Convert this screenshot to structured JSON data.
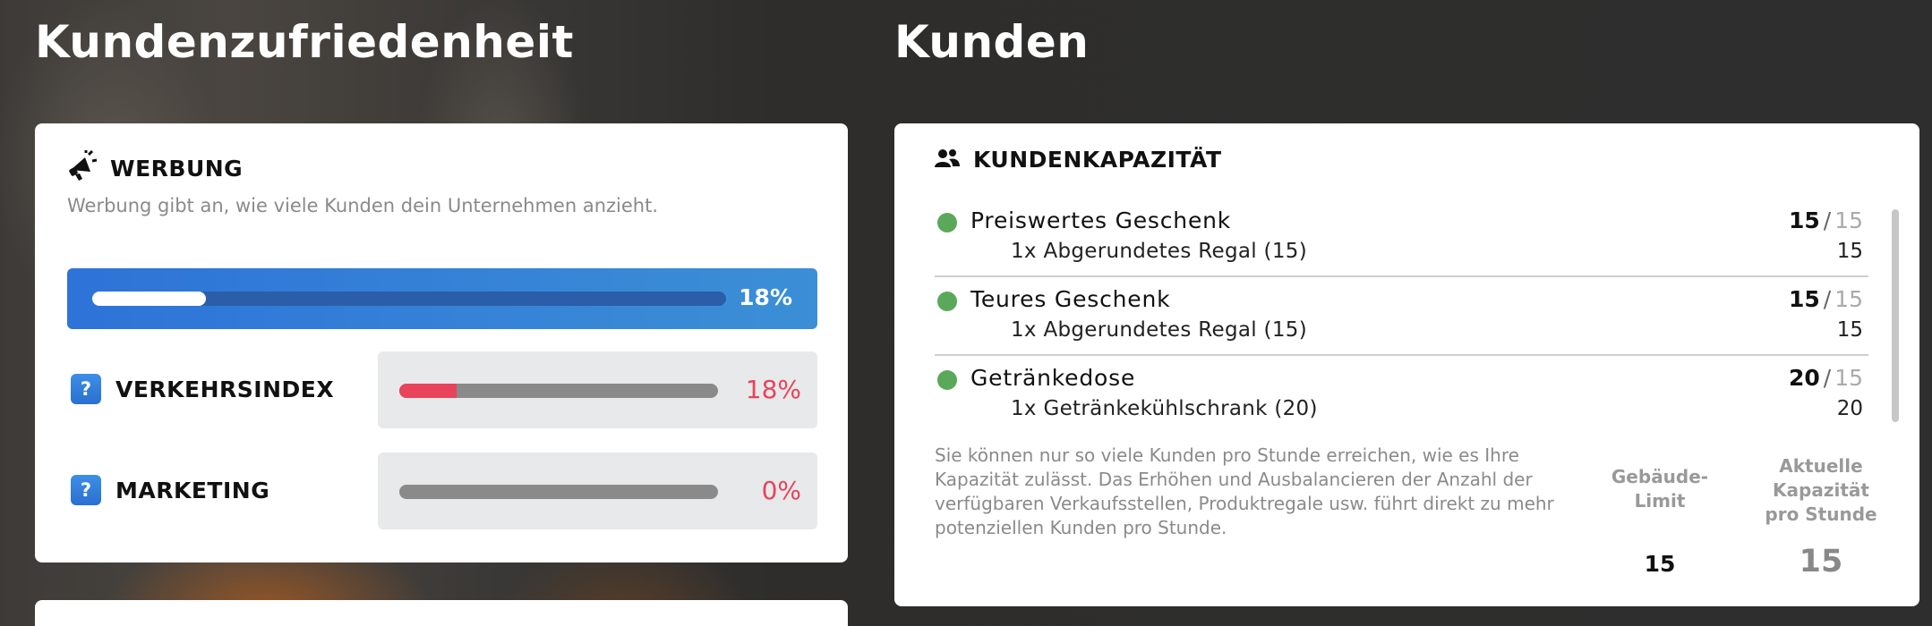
{
  "left_section": {
    "title": "Kundenzufriedenheit",
    "card": {
      "header_label": "WERBUNG",
      "description": "Werbung gibt an, wie viele Kunden dein Unternehmen anzieht.",
      "main_progress": {
        "value": 0.18,
        "label": "18%"
      },
      "metrics": [
        {
          "label": "VERKEHRSINDEX",
          "value": 0.18,
          "pct_label": "18%",
          "help_icon": "question-icon"
        },
        {
          "label": "MARKETING",
          "value": 0.0,
          "pct_label": "0%",
          "help_icon": "question-icon"
        }
      ],
      "icon": "megaphone-icon"
    }
  },
  "right_section": {
    "title": "Kunden",
    "card": {
      "header_label": "KUNDENKAPAZITÄT",
      "icon": "users-icon",
      "rows": [
        {
          "name": "Preiswertes Geschenk",
          "current": "15",
          "separator": "/",
          "max": "15",
          "sub": "1x Abgerundetes Regal (15)",
          "sub_value": "15"
        },
        {
          "name": "Teures Geschenk",
          "current": "15",
          "separator": "/",
          "max": "15",
          "sub": "1x Abgerundetes Regal (15)",
          "sub_value": "15"
        },
        {
          "name": "Getränkedose",
          "current": "20",
          "separator": "/",
          "max": "15",
          "sub": "1x Getränkekühlschrank (20)",
          "sub_value": "20"
        }
      ],
      "note": "Sie können nur so viele Kunden pro Stunde erreichen, wie es Ihre Kapazität zulässt. Das Erhöhen und Ausbalancieren der Anzahl der verfügbaren Verkaufsstellen, Produktregale usw. führt direkt zu mehr potenziellen Kunden pro Stunde.",
      "col1_header": "Gebäude-\nLimit",
      "col1_value": "15",
      "col2_header": "Aktuelle\nKapazität\npro Stunde",
      "col2_value": "15",
      "status_color": "#5aa85a"
    }
  },
  "colors": {
    "accent_blue": "#2e73d8",
    "danger_red": "#e8435a",
    "ok_green": "#5aa85a"
  }
}
